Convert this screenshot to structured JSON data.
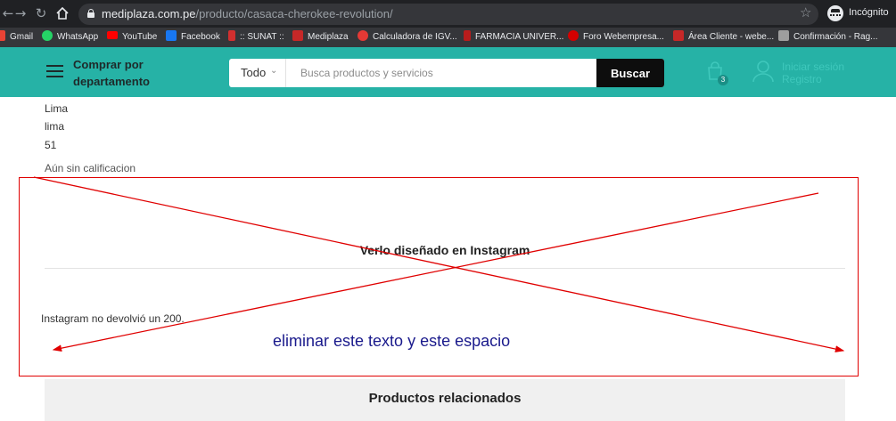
{
  "browser": {
    "url_host": "mediplaza.com.pe",
    "url_path": "/producto/casaca-cherokee-revolution/",
    "incognito_label": "Incógnito",
    "bookmarks": [
      {
        "label": "Gmail",
        "icon": "gmail-icon",
        "color": "#ea4335"
      },
      {
        "label": "WhatsApp",
        "icon": "whatsapp-icon",
        "color": "#25d366"
      },
      {
        "label": "YouTube",
        "icon": "youtube-icon",
        "color": "#ff0000"
      },
      {
        "label": "Facebook",
        "icon": "facebook-icon",
        "color": "#1877f2"
      },
      {
        "label": ":: SUNAT ::",
        "icon": "sunat-icon",
        "color": "#d32f2f"
      },
      {
        "label": "Mediplaza",
        "icon": "mediplaza-icon",
        "color": "#c62828"
      },
      {
        "label": "Calculadora de IGV...",
        "icon": "calculator-icon",
        "color": "#e53935"
      },
      {
        "label": "FARMACIA UNIVER...",
        "icon": "pharmacy-icon",
        "color": "#b71c1c"
      },
      {
        "label": "Foro Webempresa...",
        "icon": "forum-icon",
        "color": "#d50000"
      },
      {
        "label": "Área Cliente - webe...",
        "icon": "webempresa-icon",
        "color": "#c62828"
      },
      {
        "label": "Confirmación - Rag...",
        "icon": "document-icon",
        "color": "#9e9e9e"
      }
    ]
  },
  "header": {
    "dept_label": "Comprar por departamento",
    "search_category": "Todo",
    "search_placeholder": "Busca productos y servicios",
    "search_button": "Buscar",
    "cart_count": "3",
    "login_line1": "Iniciar sesión",
    "login_line2": "Registro",
    "brand_color": "#26b2a6"
  },
  "content": {
    "address_lines": [
      "Lima",
      "lima",
      "51"
    ],
    "rating_text": "Aún sin calificacion",
    "instagram_title": "Verlo diseñado en Instagram",
    "instagram_error": "Instagram no devolvió un 200.",
    "related_title": "Productos relacionados"
  },
  "annotation": {
    "note": "eliminar este texto y este espacio",
    "color": "#e00000"
  }
}
